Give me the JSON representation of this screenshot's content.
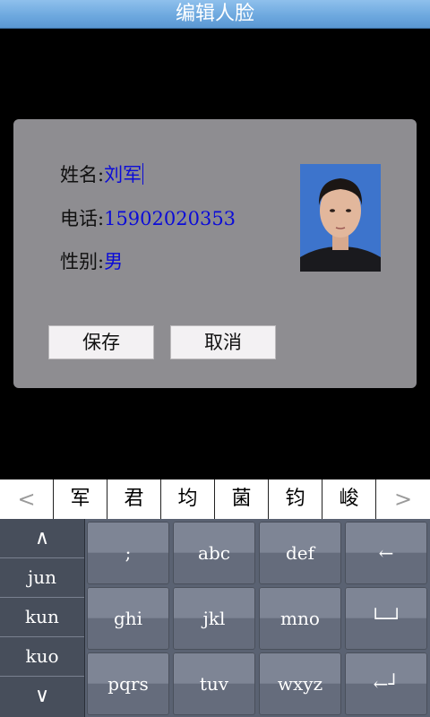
{
  "title": "编辑人脸",
  "form": {
    "name_label": "姓名:",
    "name_value": "刘军",
    "phone_label": "电话:",
    "phone_value": "15902020353",
    "gender_label": "性别:",
    "gender_value": "男"
  },
  "buttons": {
    "save": "保存",
    "cancel": "取消"
  },
  "candidates": {
    "prev": "<",
    "items": [
      "军",
      "君",
      "均",
      "菌",
      "钧",
      "峻"
    ],
    "next": ">"
  },
  "pinyin": {
    "up": "∧",
    "items": [
      "jun",
      "kun",
      "kuo"
    ],
    "down": "∨"
  },
  "keys": [
    [
      ";",
      "abc",
      "def",
      "←"
    ],
    [
      "ghi",
      "jkl",
      "mno",
      "└─┘"
    ],
    [
      "pqrs",
      "tuv",
      "wxyz",
      "←┘"
    ]
  ]
}
